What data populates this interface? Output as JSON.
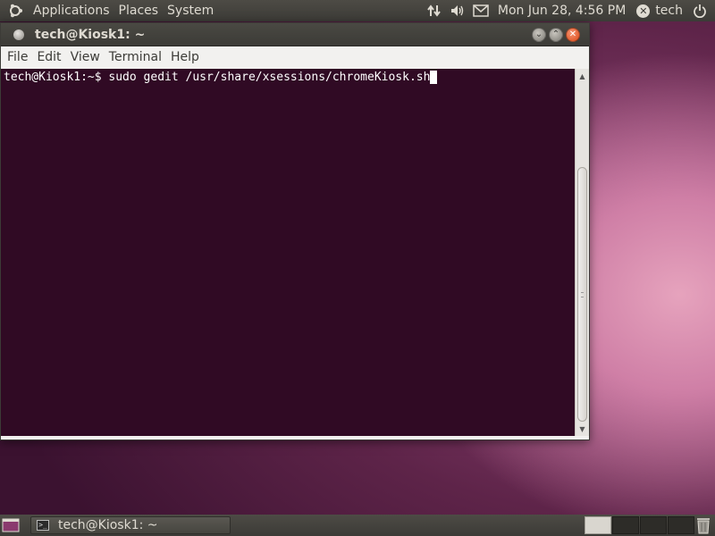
{
  "top_panel": {
    "menus": [
      "Applications",
      "Places",
      "System"
    ],
    "clock": "Mon Jun 28,  4:56 PM",
    "user": "tech",
    "icons": [
      "ubuntu-logo",
      "network-icon",
      "volume-icon",
      "mail-icon",
      "user-status-icon",
      "power-icon"
    ]
  },
  "window": {
    "title": "tech@Kiosk1: ~",
    "menu": {
      "file": "File",
      "edit": "Edit",
      "view": "View",
      "terminal": "Terminal",
      "help": "Help"
    },
    "terminal": {
      "prompt": "tech@Kiosk1:~$ ",
      "command": "sudo gedit /usr/share/xsessions/chromeKiosk.sh",
      "background": "#300a24",
      "foreground": "#ffffff"
    }
  },
  "bottom_panel": {
    "task_label": "tech@Kiosk1: ~",
    "workspaces": 4,
    "active_workspace": 1
  },
  "colors": {
    "panel": "#3c3b37",
    "accent_close": "#dd4814"
  }
}
